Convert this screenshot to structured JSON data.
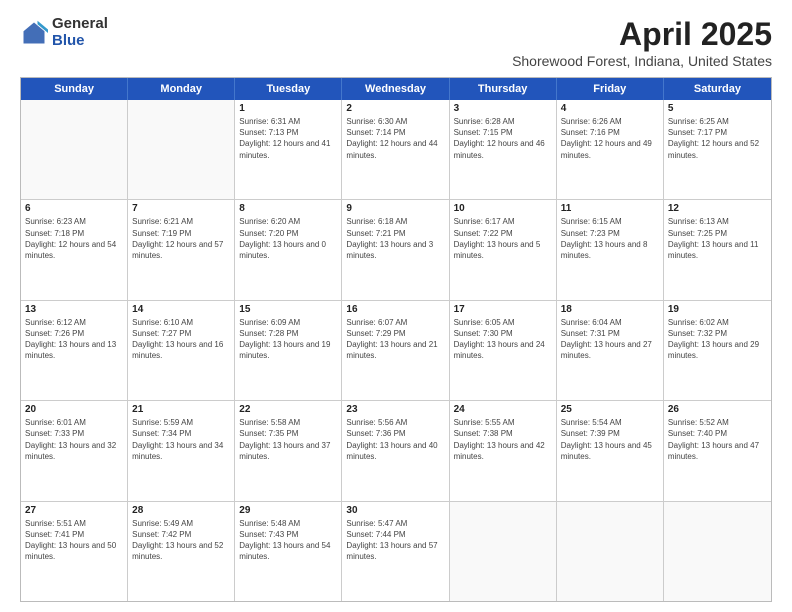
{
  "header": {
    "logo": {
      "general": "General",
      "blue": "Blue"
    },
    "title": "April 2025",
    "location": "Shorewood Forest, Indiana, United States"
  },
  "weekdays": [
    "Sunday",
    "Monday",
    "Tuesday",
    "Wednesday",
    "Thursday",
    "Friday",
    "Saturday"
  ],
  "weeks": [
    [
      {
        "day": "",
        "empty": true
      },
      {
        "day": "",
        "empty": true
      },
      {
        "day": "1",
        "sunrise": "Sunrise: 6:31 AM",
        "sunset": "Sunset: 7:13 PM",
        "daylight": "Daylight: 12 hours and 41 minutes."
      },
      {
        "day": "2",
        "sunrise": "Sunrise: 6:30 AM",
        "sunset": "Sunset: 7:14 PM",
        "daylight": "Daylight: 12 hours and 44 minutes."
      },
      {
        "day": "3",
        "sunrise": "Sunrise: 6:28 AM",
        "sunset": "Sunset: 7:15 PM",
        "daylight": "Daylight: 12 hours and 46 minutes."
      },
      {
        "day": "4",
        "sunrise": "Sunrise: 6:26 AM",
        "sunset": "Sunset: 7:16 PM",
        "daylight": "Daylight: 12 hours and 49 minutes."
      },
      {
        "day": "5",
        "sunrise": "Sunrise: 6:25 AM",
        "sunset": "Sunset: 7:17 PM",
        "daylight": "Daylight: 12 hours and 52 minutes."
      }
    ],
    [
      {
        "day": "6",
        "sunrise": "Sunrise: 6:23 AM",
        "sunset": "Sunset: 7:18 PM",
        "daylight": "Daylight: 12 hours and 54 minutes."
      },
      {
        "day": "7",
        "sunrise": "Sunrise: 6:21 AM",
        "sunset": "Sunset: 7:19 PM",
        "daylight": "Daylight: 12 hours and 57 minutes."
      },
      {
        "day": "8",
        "sunrise": "Sunrise: 6:20 AM",
        "sunset": "Sunset: 7:20 PM",
        "daylight": "Daylight: 13 hours and 0 minutes."
      },
      {
        "day": "9",
        "sunrise": "Sunrise: 6:18 AM",
        "sunset": "Sunset: 7:21 PM",
        "daylight": "Daylight: 13 hours and 3 minutes."
      },
      {
        "day": "10",
        "sunrise": "Sunrise: 6:17 AM",
        "sunset": "Sunset: 7:22 PM",
        "daylight": "Daylight: 13 hours and 5 minutes."
      },
      {
        "day": "11",
        "sunrise": "Sunrise: 6:15 AM",
        "sunset": "Sunset: 7:23 PM",
        "daylight": "Daylight: 13 hours and 8 minutes."
      },
      {
        "day": "12",
        "sunrise": "Sunrise: 6:13 AM",
        "sunset": "Sunset: 7:25 PM",
        "daylight": "Daylight: 13 hours and 11 minutes."
      }
    ],
    [
      {
        "day": "13",
        "sunrise": "Sunrise: 6:12 AM",
        "sunset": "Sunset: 7:26 PM",
        "daylight": "Daylight: 13 hours and 13 minutes."
      },
      {
        "day": "14",
        "sunrise": "Sunrise: 6:10 AM",
        "sunset": "Sunset: 7:27 PM",
        "daylight": "Daylight: 13 hours and 16 minutes."
      },
      {
        "day": "15",
        "sunrise": "Sunrise: 6:09 AM",
        "sunset": "Sunset: 7:28 PM",
        "daylight": "Daylight: 13 hours and 19 minutes."
      },
      {
        "day": "16",
        "sunrise": "Sunrise: 6:07 AM",
        "sunset": "Sunset: 7:29 PM",
        "daylight": "Daylight: 13 hours and 21 minutes."
      },
      {
        "day": "17",
        "sunrise": "Sunrise: 6:05 AM",
        "sunset": "Sunset: 7:30 PM",
        "daylight": "Daylight: 13 hours and 24 minutes."
      },
      {
        "day": "18",
        "sunrise": "Sunrise: 6:04 AM",
        "sunset": "Sunset: 7:31 PM",
        "daylight": "Daylight: 13 hours and 27 minutes."
      },
      {
        "day": "19",
        "sunrise": "Sunrise: 6:02 AM",
        "sunset": "Sunset: 7:32 PM",
        "daylight": "Daylight: 13 hours and 29 minutes."
      }
    ],
    [
      {
        "day": "20",
        "sunrise": "Sunrise: 6:01 AM",
        "sunset": "Sunset: 7:33 PM",
        "daylight": "Daylight: 13 hours and 32 minutes."
      },
      {
        "day": "21",
        "sunrise": "Sunrise: 5:59 AM",
        "sunset": "Sunset: 7:34 PM",
        "daylight": "Daylight: 13 hours and 34 minutes."
      },
      {
        "day": "22",
        "sunrise": "Sunrise: 5:58 AM",
        "sunset": "Sunset: 7:35 PM",
        "daylight": "Daylight: 13 hours and 37 minutes."
      },
      {
        "day": "23",
        "sunrise": "Sunrise: 5:56 AM",
        "sunset": "Sunset: 7:36 PM",
        "daylight": "Daylight: 13 hours and 40 minutes."
      },
      {
        "day": "24",
        "sunrise": "Sunrise: 5:55 AM",
        "sunset": "Sunset: 7:38 PM",
        "daylight": "Daylight: 13 hours and 42 minutes."
      },
      {
        "day": "25",
        "sunrise": "Sunrise: 5:54 AM",
        "sunset": "Sunset: 7:39 PM",
        "daylight": "Daylight: 13 hours and 45 minutes."
      },
      {
        "day": "26",
        "sunrise": "Sunrise: 5:52 AM",
        "sunset": "Sunset: 7:40 PM",
        "daylight": "Daylight: 13 hours and 47 minutes."
      }
    ],
    [
      {
        "day": "27",
        "sunrise": "Sunrise: 5:51 AM",
        "sunset": "Sunset: 7:41 PM",
        "daylight": "Daylight: 13 hours and 50 minutes."
      },
      {
        "day": "28",
        "sunrise": "Sunrise: 5:49 AM",
        "sunset": "Sunset: 7:42 PM",
        "daylight": "Daylight: 13 hours and 52 minutes."
      },
      {
        "day": "29",
        "sunrise": "Sunrise: 5:48 AM",
        "sunset": "Sunset: 7:43 PM",
        "daylight": "Daylight: 13 hours and 54 minutes."
      },
      {
        "day": "30",
        "sunrise": "Sunrise: 5:47 AM",
        "sunset": "Sunset: 7:44 PM",
        "daylight": "Daylight: 13 hours and 57 minutes."
      },
      {
        "day": "",
        "empty": true
      },
      {
        "day": "",
        "empty": true
      },
      {
        "day": "",
        "empty": true
      }
    ]
  ]
}
